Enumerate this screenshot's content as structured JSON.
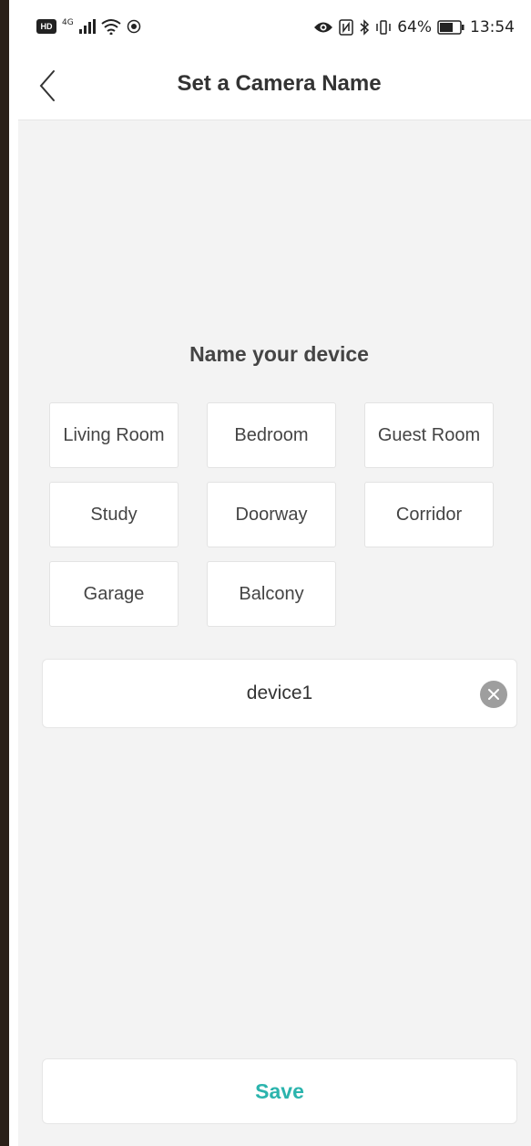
{
  "status_bar": {
    "hd": "HD",
    "network": "4G",
    "battery_percent": "64%",
    "time": "13:54"
  },
  "header": {
    "title": "Set a Camera Name"
  },
  "main": {
    "section_title": "Name your device",
    "presets": [
      "Living Room",
      "Bedroom",
      "Guest Room",
      "Study",
      "Doorway",
      "Corridor",
      "Garage",
      "Balcony"
    ],
    "name_input": {
      "value": "device1"
    },
    "save_label": "Save"
  },
  "colors": {
    "accent": "#2bb4ad",
    "background": "#f3f3f3",
    "clear_button": "#9e9e9e"
  },
  "icons": {
    "back": "chevron-left-icon",
    "clear": "close-circle-icon"
  }
}
